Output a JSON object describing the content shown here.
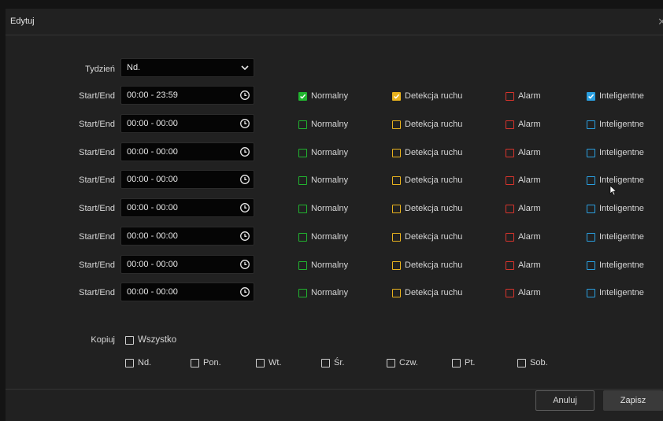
{
  "dialog": {
    "title": "Edytuj"
  },
  "week": {
    "label": "Tydzień",
    "value": "Nd."
  },
  "schedule": {
    "row_label": "Start/End",
    "type_labels": {
      "normal": "Normalny",
      "motion": "Detekcja ruchu",
      "alarm": "Alarm",
      "smart": "Inteligentne"
    },
    "colors": {
      "normal": "#21b42f",
      "motion": "#e8b21e",
      "alarm": "#d8342c",
      "smart": "#2a9fe0"
    },
    "rows": [
      {
        "time": "00:00 - 23:59",
        "normal": true,
        "motion": true,
        "alarm": false,
        "smart": true
      },
      {
        "time": "00:00 - 00:00",
        "normal": false,
        "motion": false,
        "alarm": false,
        "smart": false
      },
      {
        "time": "00:00 - 00:00",
        "normal": false,
        "motion": false,
        "alarm": false,
        "smart": false
      },
      {
        "time": "00:00 - 00:00",
        "normal": false,
        "motion": false,
        "alarm": false,
        "smart": false
      },
      {
        "time": "00:00 - 00:00",
        "normal": false,
        "motion": false,
        "alarm": false,
        "smart": false
      },
      {
        "time": "00:00 - 00:00",
        "normal": false,
        "motion": false,
        "alarm": false,
        "smart": false
      },
      {
        "time": "00:00 - 00:00",
        "normal": false,
        "motion": false,
        "alarm": false,
        "smart": false
      },
      {
        "time": "00:00 - 00:00",
        "normal": false,
        "motion": false,
        "alarm": false,
        "smart": false
      }
    ]
  },
  "copy": {
    "label": "Kopiuj",
    "all_label": "Wszystko",
    "days": [
      "Nd.",
      "Pon.",
      "Wt.",
      "Śr.",
      "Czw.",
      "Pt.",
      "Sob."
    ]
  },
  "footer": {
    "cancel_label": "Anuluj",
    "save_label": "Zapisz"
  }
}
